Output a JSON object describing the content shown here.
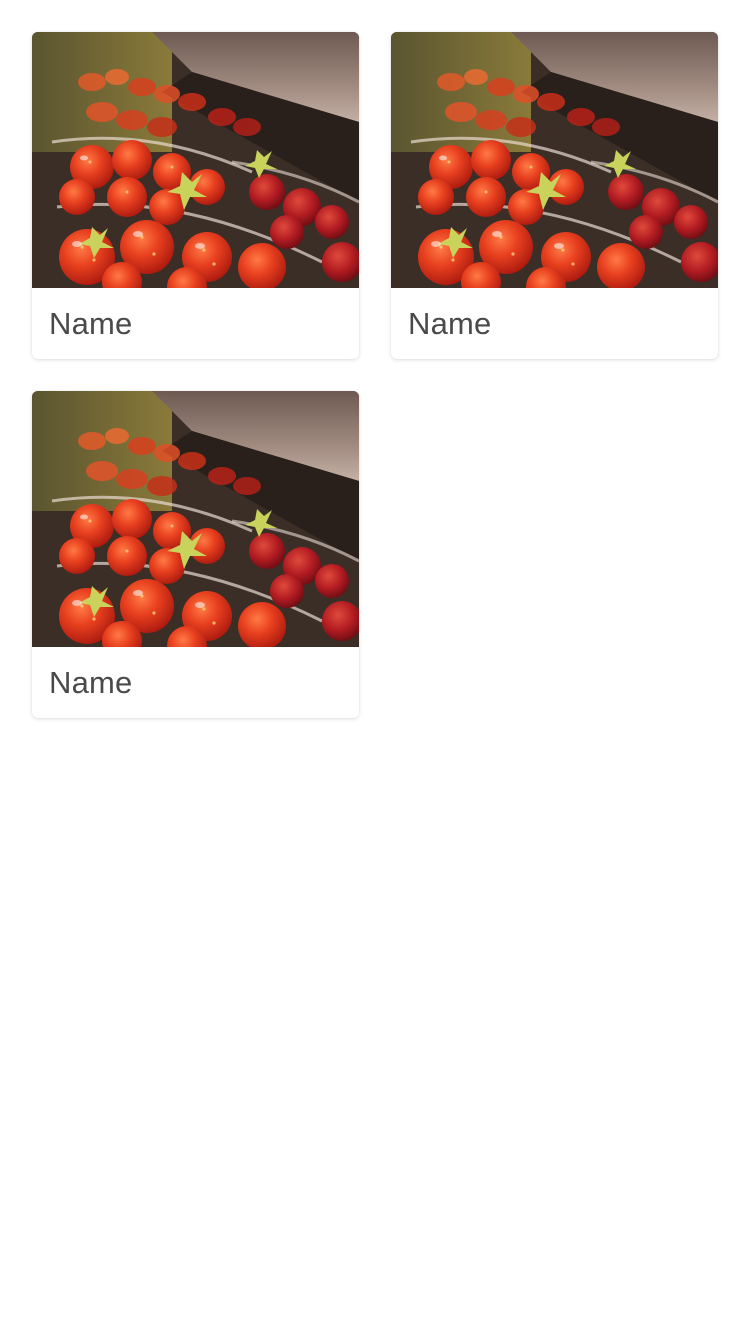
{
  "products": {
    "items": [
      {
        "name": "Name",
        "image_icon": "strawberries-photo"
      },
      {
        "name": "Name",
        "image_icon": "strawberries-photo"
      },
      {
        "name": "Name",
        "image_icon": "strawberries-photo"
      }
    ]
  },
  "colors": {
    "background": "#ffffff",
    "card_text": "#4a4a4a",
    "strawberry_red": "#d8321a",
    "shelf_dark": "#2b211c"
  }
}
